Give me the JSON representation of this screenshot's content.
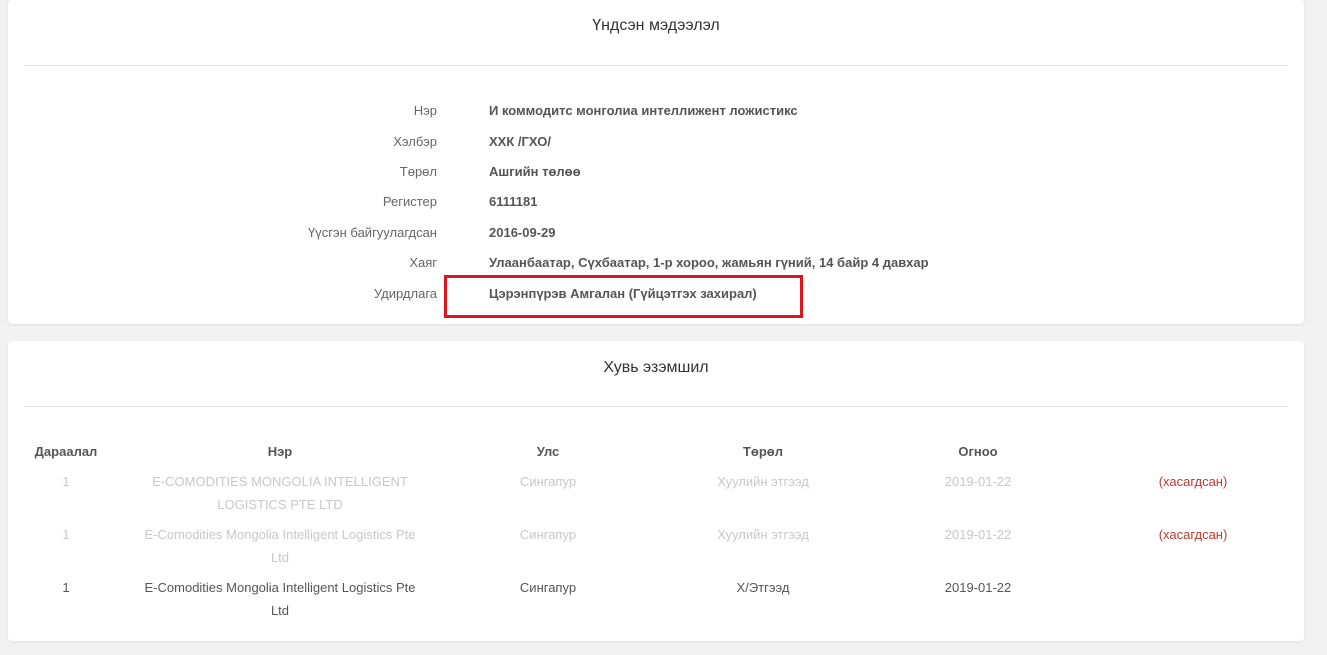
{
  "basic_info": {
    "title": "Үндсэн мэдээлэл",
    "rows": [
      {
        "label": "Нэр",
        "value": "И коммодитс монголиа интеллижент ложистикс"
      },
      {
        "label": "Хэлбэр",
        "value": "ХХК /ГХО/"
      },
      {
        "label": "Төрөл",
        "value": "Ашгийн төлөө"
      },
      {
        "label": "Регистер",
        "value": "6111181"
      },
      {
        "label": "Үүсгэн байгуулагдсан",
        "value": "2016-09-29"
      },
      {
        "label": "Хаяг",
        "value": "Улаанбаатар, Сүхбаатар, 1-р хороо, жамьян гүний, 14 байр 4 давхар"
      },
      {
        "label": "Удирдлага",
        "value": "Цэрэнпүрэв Амгалан (Гүйцэтгэх захирал)"
      }
    ],
    "highlight_color": "#e0141b"
  },
  "ownership": {
    "title": "Хувь эзэмшил",
    "columns": [
      "Дараалал",
      "Нэр",
      "Улс",
      "Төрөл",
      "Огноо"
    ],
    "rows": [
      {
        "order": "1",
        "name_line1": "E-COMODITIES MONGOLIA INTELLIGENT",
        "name_line2": "LOGISTICS PTE LTD",
        "country": "Сингапур",
        "type": "Хуулийн этгээд",
        "date": "2019-01-22",
        "status": "(хасагдсан)"
      },
      {
        "order": "1",
        "name_line1": "E-Comodities Mongolia Intelligent Logistics Pte",
        "name_line2": "Ltd",
        "country": "Сингапур",
        "type": "Хуулийн этгээд",
        "date": "2019-01-22",
        "status": "(хасагдсан)"
      },
      {
        "order": "1",
        "name_line1": "E-Comodities Mongolia Intelligent Logistics Pte",
        "name_line2": "Ltd",
        "country": "Сингапур",
        "type": "Х/Этгээд",
        "date": "2019-01-22",
        "status": ""
      }
    ],
    "status_color": "#c0392b"
  }
}
